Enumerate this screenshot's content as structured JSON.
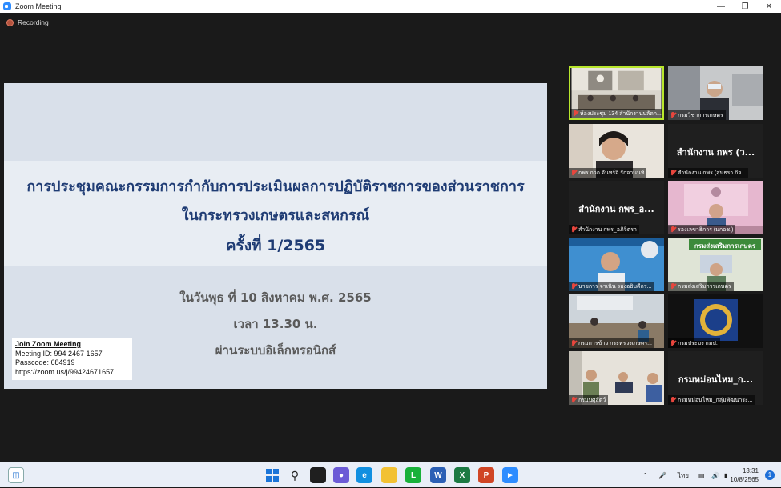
{
  "window": {
    "title": "Zoom Meeting"
  },
  "recording": {
    "label": "Recording"
  },
  "slide": {
    "title_lines": [
      "การประชุมคณะกรรมการกำกับการประเมินผลการปฏิบัติราชการของส่วนราชการ",
      "ในกระทรวงเกษตรและสหกรณ์",
      "ครั้งที่ 1/2565"
    ],
    "detail_lines": [
      "ในวันพุธ ที่ 10 สิงหาคม พ.ศ. 2565",
      "เวลา 13.30 น.",
      "ผ่านระบบอิเล็กทรอนิกส์"
    ]
  },
  "join_info": {
    "heading": "Join Zoom Meeting",
    "meeting_id": "Meeting ID: 994 2467 1657",
    "passcode": "Passcode: 684919",
    "url": "https://zoom.us/j/99424671657"
  },
  "participants": [
    {
      "name": "ห้องประชุม 134 สำนักงานปลัดก...",
      "video": true,
      "active": true
    },
    {
      "name": "กรมวิชาการเกษตร",
      "video": true
    },
    {
      "name": "กพร.กวก.จันทร์จิ รักจานนท์",
      "video": true
    },
    {
      "name": "สำนักงาน กพร (สุนธรา กิจ...",
      "video": false,
      "display": "สำนักงาน กพร (ว..."
    },
    {
      "name": "สำนักงาน กพร_อภิจิตรา",
      "video": false,
      "display": "สำนักงาน กพร_อ..."
    },
    {
      "name": "รองเลขาธิการ (มกอช.)",
      "video": true
    },
    {
      "name": "นายการ จาเนิน รองอธิบดีกร...",
      "video": true
    },
    {
      "name": "กรมส่งเสริมการเกษตร",
      "video": true,
      "banner": "กรมส่งเสริมการเกษตร"
    },
    {
      "name": "กรมการข้าว กระทรวงเกษตร...",
      "video": true
    },
    {
      "name": "กรมประมง กมป.",
      "video": true
    },
    {
      "name": "กรมปศุสัตว์",
      "video": true
    },
    {
      "name": "กรมหม่อนไหม_กลุ่มพัฒนาระ...",
      "video": false,
      "display": "กรมหม่อนไหม_ก..."
    }
  ],
  "taskbar": {
    "language": "ไทย",
    "time": "13:31",
    "date": "10/8/2565",
    "notifications": "1"
  },
  "colors": {
    "accent": "#b8e62c",
    "title_text": "#1f3c74",
    "mic_muted": "#e8463d"
  }
}
